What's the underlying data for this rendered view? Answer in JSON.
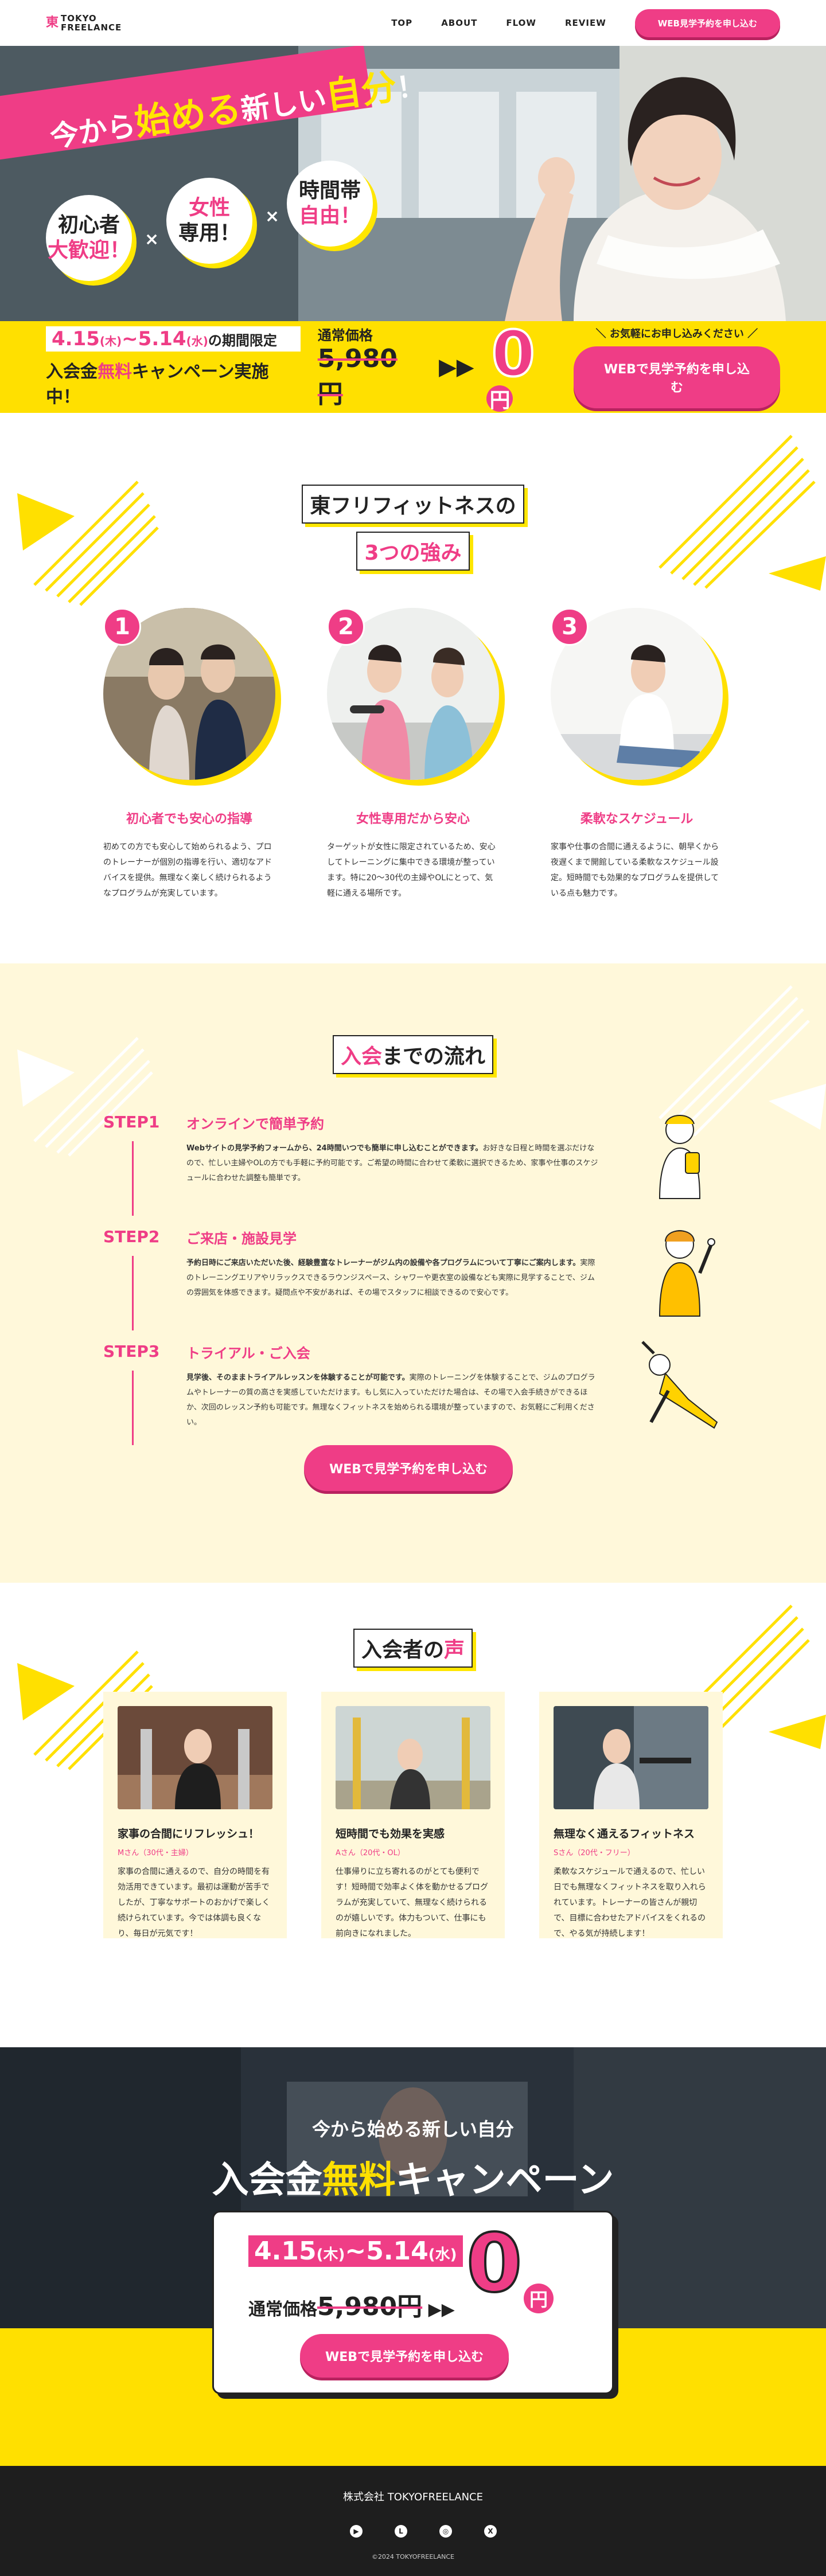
{
  "header": {
    "logo_mark": "東",
    "logo_line1": "TOKYO",
    "logo_line2": "FREELANCE",
    "nav": [
      "TOP",
      "ABOUT",
      "FLOW",
      "REVIEW"
    ],
    "cta": "WEB見学予約を申し込む"
  },
  "hero": {
    "catch_a": "今から",
    "catch_b": "始める",
    "catch_c": "新しい",
    "catch_d": "自分",
    "catch_e": "！",
    "circle1": "初心者大歓迎！",
    "circle1_a": "初心者",
    "circle1_b": "大歓迎！",
    "circle2_a": "女性",
    "circle2_b": "専用！",
    "circle3_a": "時間帯",
    "circle3_b": "自由！",
    "times": "×"
  },
  "campaign": {
    "date_a": "4.15",
    "date_a_day": "(木)",
    "date_sep": "~",
    "date_b": "5.14",
    "date_b_day": "(水)",
    "date_suffix": "の期間限定",
    "sub_a": "入会金",
    "sub_b": "無料",
    "sub_c": "キャンペーン実施中！",
    "price_label": "通常価格",
    "price_old": "5,980円",
    "arrows": "▶▶",
    "zero": "0",
    "yen": "円",
    "note": "＼ お気軽にお申し込みください ／",
    "cta": "WEBで見学予約を申し込む"
  },
  "strengths": {
    "title1": "東フリフィットネスの",
    "title2": "3つの強み",
    "items": [
      {
        "num": "1",
        "heading": "初心者でも安心の指導",
        "text": "初めての方でも安心して始められるよう、プロのトレーナーが個別の指導を行い、適切なアドバイスを提供。無理なく楽しく続けられるようなプログラムが充実しています。"
      },
      {
        "num": "2",
        "heading": "女性専用だから安心",
        "text": "ターゲットが女性に限定されているため、安心してトレーニングに集中できる環境が整っています。特に20～30代の主婦やOLにとって、気軽に通える場所です。"
      },
      {
        "num": "3",
        "heading": "柔軟なスケジュール",
        "text": "家事や仕事の合間に通えるように、朝早くから夜遅くまで開館している柔軟なスケジュール設定。短時間でも効果的なプログラムを提供している点も魅力です。"
      }
    ]
  },
  "flow": {
    "title_a": "入会",
    "title_b": "までの流れ",
    "steps": [
      {
        "label": "STEP1",
        "title": "オンラインで簡単予約",
        "bold": "Webサイトの見学予約フォームから、24時間いつでも簡単に申し込むことができます。",
        "text": "お好きな日程と時間を選ぶだけなので、忙しい主婦やOLの方でも手軽に予約可能です。ご希望の時間に合わせて柔軟に選択できるため、家事や仕事のスケジュールに合わせた調整も簡単です。"
      },
      {
        "label": "STEP2",
        "title": "ご来店・施設見学",
        "bold": "予約日時にご来店いただいた後、経験豊富なトレーナーがジム内の設備や各プログラムについて丁寧にご案内します。",
        "text": "実際のトレーニングエリアやリラックスできるラウンジスペース、シャワーや更衣室の設備なども実際に見学することで、ジムの雰囲気を体感できます。疑問点や不安があれば、その場でスタッフに相談できるので安心です。"
      },
      {
        "label": "STEP3",
        "title": "トライアル・ご入会",
        "bold": "見学後、そのままトライアルレッスンを体験することが可能です。",
        "text": "実際のトレーニングを体験することで、ジムのプログラムやトレーナーの質の高さを実感していただけます。もし気に入っていただけた場合は、その場で入会手続きができるほか、次回のレッスン予約も可能です。無理なくフィットネスを始められる環境が整っていますので、お気軽にご利用ください。"
      }
    ],
    "cta": "WEBで見学予約を申し込む"
  },
  "voices": {
    "title_a": "入会者の",
    "title_b": "声",
    "items": [
      {
        "heading": "家事の合間にリフレッシュ！",
        "who": "Mさん（30代・主婦）",
        "text": "家事の合間に通えるので、自分の時間を有効活用できています。最初は運動が苦手でしたが、丁寧なサポートのおかげで楽しく続けられています。今では体調も良くなり、毎日が元気です！"
      },
      {
        "heading": "短時間でも効果を実感",
        "who": "Aさん（20代・OL）",
        "text": "仕事帰りに立ち寄れるのがとても便利です！短時間で効率よく体を動かせるプログラムが充実していて、無理なく続けられるのが嬉しいです。体力もついて、仕事にも前向きになれました。"
      },
      {
        "heading": "無理なく通えるフィットネス",
        "who": "Sさん（20代・フリー）",
        "text": "柔軟なスケジュールで通えるので、忙しい日でも無理なくフィットネスを取り入れられています。トレーナーの皆さんが親切で、目標に合わせたアドバイスをくれるので、やる気が持続します！"
      }
    ]
  },
  "bottom": {
    "sub": "今から始める新しい自分",
    "title_a": "入会金",
    "title_b": "無料",
    "title_c": "キャンペーン",
    "date_a": "4.15",
    "date_a_day": "(木)",
    "date_sep": "~",
    "date_b": "5.14",
    "date_b_day": "(水)",
    "price_label": "通常価格",
    "price_old": "5,980円",
    "arrows": "▶▶",
    "zero": "0",
    "yen": "円",
    "cta": "WEBで見学予約を申し込む"
  },
  "footer": {
    "company": "株式会社 TOKYOFREELANCE",
    "icons": [
      "youtube-icon",
      "line-icon",
      "instagram-icon",
      "x-icon"
    ],
    "icon_glyphs": [
      "▶",
      "L",
      "◎",
      "X"
    ],
    "copyright": "©2024 TOKYOFREELANCE"
  },
  "colors": {
    "pink": "#ef3d86",
    "yellow": "#ffe000",
    "cream": "#fff8da",
    "dark": "#1e1e1e"
  }
}
